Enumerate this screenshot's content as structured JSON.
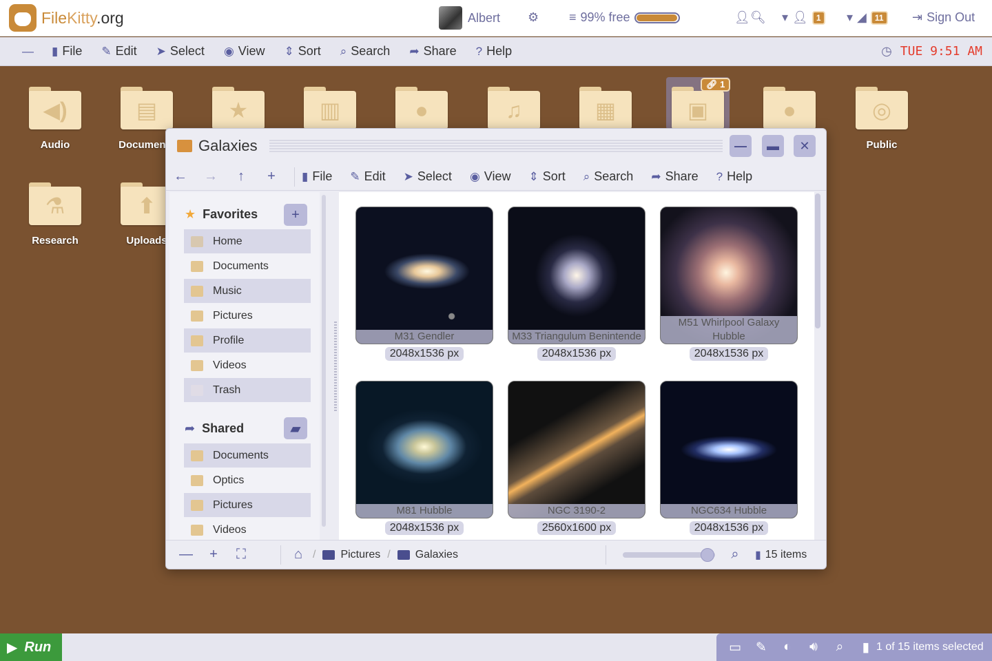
{
  "header": {
    "logo_text_a": "File",
    "logo_text_b": "Kitty",
    "logo_text_c": ".org",
    "user_name": "Albert",
    "storage_label": "99% free",
    "storage_fraction": 0.99,
    "badge_users": "1",
    "badge_notifications": "11",
    "sign_out": "Sign Out"
  },
  "menubar": {
    "items": [
      "File",
      "Edit",
      "Select",
      "View",
      "Sort",
      "Search",
      "Share",
      "Help"
    ],
    "clock": "TUE 9:51 AM"
  },
  "desktop": {
    "icons": [
      "Audio",
      "Documents",
      "",
      "",
      "",
      "",
      "",
      "",
      "",
      "Public",
      "Research",
      "Uploads"
    ],
    "link_badge": "1"
  },
  "window": {
    "title": "Galaxies",
    "toolbar": [
      "File",
      "Edit",
      "Select",
      "View",
      "Sort",
      "Search",
      "Share",
      "Help"
    ],
    "sidebar": {
      "favorites_label": "Favorites",
      "favorites": [
        "Home",
        "Documents",
        "Music",
        "Pictures",
        "Profile",
        "Videos",
        "Trash"
      ],
      "shared_label": "Shared",
      "shared": [
        "Documents",
        "Optics",
        "Pictures",
        "Videos"
      ]
    },
    "files": [
      {
        "name": "M31 Gendler",
        "dims": "2048x1536 px"
      },
      {
        "name": "M33 Triangulum Benintende",
        "dims": "2048x1536 px"
      },
      {
        "name": "M51 Whirlpool Galaxy Hubble",
        "dims": "2048x1536 px"
      },
      {
        "name": "M81 Hubble",
        "dims": "2048x1536 px"
      },
      {
        "name": "NGC 3190-2",
        "dims": "2560x1600 px"
      },
      {
        "name": "NGC634 Hubble",
        "dims": "2048x1536 px"
      }
    ],
    "status": {
      "crumb1": "Pictures",
      "crumb2": "Galaxies",
      "zoom_fraction": 0.92,
      "item_count": "15 items"
    }
  },
  "bottombar": {
    "run": "Run",
    "selection": "1 of 15 items selected"
  }
}
